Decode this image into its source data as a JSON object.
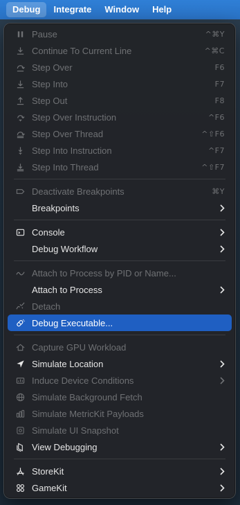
{
  "menubar": {
    "items": [
      "Debug",
      "Integrate",
      "Window",
      "Help"
    ]
  },
  "menu": {
    "pause": {
      "label": "Pause",
      "shortcut": "^⌘Y"
    },
    "continue": {
      "label": "Continue To Current Line",
      "shortcut": "^⌘C"
    },
    "step_over": {
      "label": "Step Over",
      "shortcut": "F6"
    },
    "step_into": {
      "label": "Step Into",
      "shortcut": "F7"
    },
    "step_out": {
      "label": "Step Out",
      "shortcut": "F8"
    },
    "step_over_instruction": {
      "label": "Step Over Instruction",
      "shortcut": "^F6"
    },
    "step_over_thread": {
      "label": "Step Over Thread",
      "shortcut": "^⇧F6"
    },
    "step_into_instruction": {
      "label": "Step Into Instruction",
      "shortcut": "^F7"
    },
    "step_into_thread": {
      "label": "Step Into Thread",
      "shortcut": "^⇧F7"
    },
    "deactivate_breakpoints": {
      "label": "Deactivate Breakpoints",
      "shortcut": "⌘Y"
    },
    "breakpoints": {
      "label": "Breakpoints"
    },
    "console": {
      "label": "Console"
    },
    "debug_workflow": {
      "label": "Debug Workflow"
    },
    "attach_pid": {
      "label": "Attach to Process by PID or Name..."
    },
    "attach_process": {
      "label": "Attach to Process"
    },
    "detach": {
      "label": "Detach"
    },
    "debug_executable": {
      "label": "Debug Executable..."
    },
    "capture_gpu": {
      "label": "Capture GPU Workload"
    },
    "simulate_location": {
      "label": "Simulate Location"
    },
    "induce_conditions": {
      "label": "Induce Device Conditions"
    },
    "simulate_bg_fetch": {
      "label": "Simulate Background Fetch"
    },
    "simulate_metrickit": {
      "label": "Simulate MetricKit Payloads"
    },
    "simulate_ui_snapshot": {
      "label": "Simulate UI Snapshot"
    },
    "view_debugging": {
      "label": "View Debugging"
    },
    "storekit": {
      "label": "StoreKit"
    },
    "gamekit": {
      "label": "GameKit"
    }
  },
  "colors": {
    "menubar": "#2f7fd6",
    "selection": "#1f5fc2",
    "menu_bg": "#222428",
    "disabled_text": "#6f7174"
  }
}
